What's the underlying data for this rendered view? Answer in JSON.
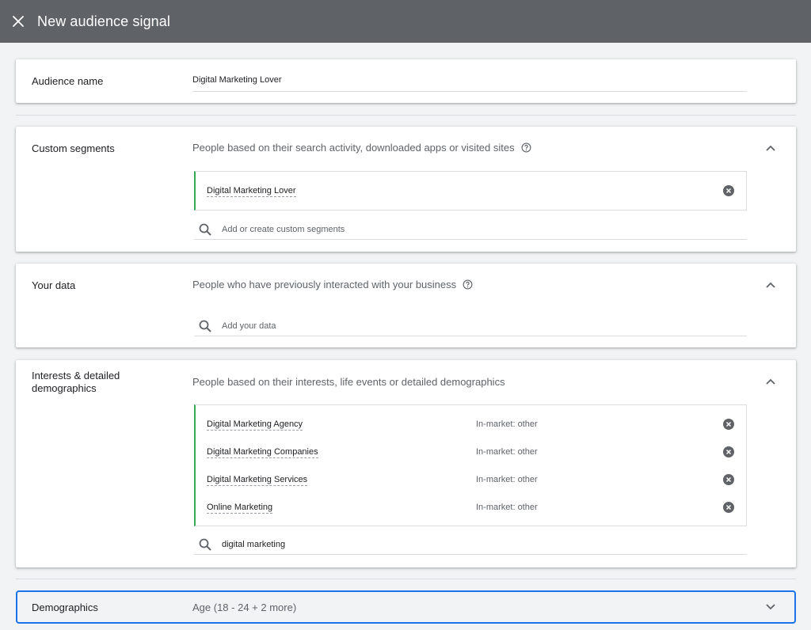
{
  "topbar": {
    "title": "New audience signal",
    "close_icon": "close-icon"
  },
  "audience_name": {
    "label": "Audience name",
    "value": "Digital Marketing Lover"
  },
  "custom_segments": {
    "label": "Custom segments",
    "description": "People based on their search activity, downloaded apps or visited sites",
    "chips": [
      {
        "name": "Digital Marketing Lover"
      }
    ],
    "search_placeholder": "Add or create custom segments"
  },
  "your_data": {
    "label": "Your data",
    "description": "People who have previously interacted with your business",
    "search_placeholder": "Add your data"
  },
  "interests": {
    "label": "Interests & detailed demographics",
    "description": "People based on their interests, life events or detailed demographics",
    "chips": [
      {
        "name": "Digital Marketing Agency",
        "category": "In-market: other"
      },
      {
        "name": "Digital Marketing Companies",
        "category": "In-market: other"
      },
      {
        "name": "Digital Marketing Services",
        "category": "In-market: other"
      },
      {
        "name": "Online Marketing",
        "category": "In-market: other"
      }
    ],
    "search_value": "digital marketing"
  },
  "demographics": {
    "label": "Demographics",
    "summary": "Age (18 - 24 + 2 more)"
  },
  "colors": {
    "topbar": "#5f6368",
    "accent_green": "#34a853",
    "focus_blue": "#1a73e8"
  }
}
